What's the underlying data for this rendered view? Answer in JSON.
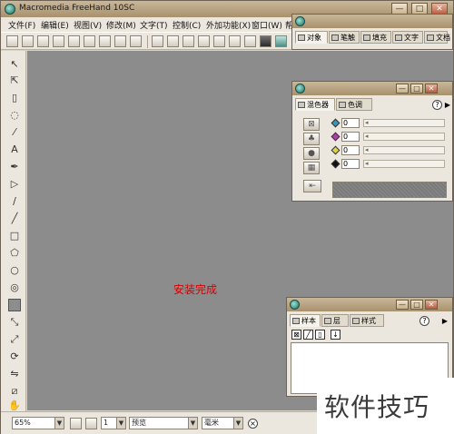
{
  "window": {
    "title": "Macromedia FreeHand 10SC",
    "min_label": "—",
    "max_label": "□",
    "close_label": "✕"
  },
  "menu": [
    "文件(F)",
    "编辑(E)",
    "视图(V)",
    "修改(M)",
    "文字(T)",
    "控制(C)",
    "外加功能(X)",
    "窗口(W)",
    "帮"
  ],
  "canvas": {
    "message": "安装完成",
    "message_color": "#d40000",
    "background": "#8c8c8c"
  },
  "top_panel": {
    "tabs": [
      "对象",
      "笔触",
      "填充",
      "文字",
      "文档"
    ],
    "help": "?",
    "menu_arrow": "▶"
  },
  "mixer_panel": {
    "tabs": [
      "混色器",
      "色调"
    ],
    "help": "?",
    "menu_arrow": "▶",
    "channels": [
      {
        "name": "cyan",
        "value": "0",
        "color": "#2a9bb8"
      },
      {
        "name": "magenta",
        "value": "0",
        "color": "#b03fa6"
      },
      {
        "name": "yellow",
        "value": "0",
        "color": "#e0d43a"
      },
      {
        "name": "black",
        "value": "0",
        "color": "#111111"
      }
    ]
  },
  "layers_panel": {
    "tabs": [
      "样本",
      "层",
      "样式"
    ],
    "help": "?",
    "menu_arrow": "▶",
    "down_arrow": "↓"
  },
  "status": {
    "zoom": "65%",
    "page": "1",
    "view_mode": "预览",
    "units": "毫米",
    "dropdown_arrow": "▼"
  },
  "watermark": "软件技巧"
}
